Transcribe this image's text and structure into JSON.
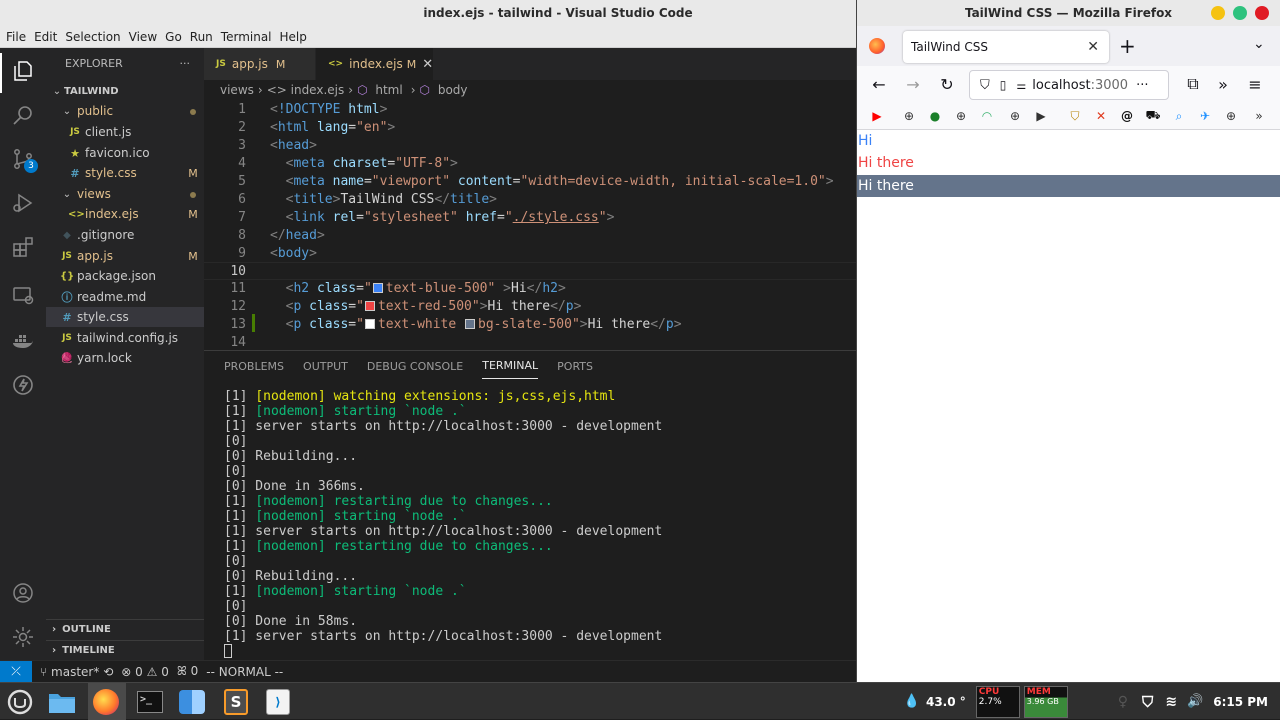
{
  "vscode": {
    "window_title": "index.ejs - tailwind - Visual Studio Code",
    "menu": [
      "File",
      "Edit",
      "Selection",
      "View",
      "Go",
      "Run",
      "Terminal",
      "Help"
    ],
    "scm_badge": "3",
    "explorer": {
      "header": "EXPLORER",
      "more": "···",
      "root": "TAILWIND",
      "items": [
        {
          "label": "public",
          "type": "folder",
          "icon": "chevron-down",
          "mark": ""
        },
        {
          "label": "client.js",
          "type": "js",
          "icon": "JS",
          "mark": ""
        },
        {
          "label": "favicon.ico",
          "type": "ico",
          "icon": "★",
          "mark": ""
        },
        {
          "label": "style.css",
          "type": "css",
          "icon": "#",
          "mark": "M"
        },
        {
          "label": "views",
          "type": "folder",
          "icon": "chevron-down",
          "mark": ""
        },
        {
          "label": "index.ejs",
          "type": "ejs",
          "icon": "<>",
          "mark": "M"
        },
        {
          "label": ".gitignore",
          "type": "git",
          "icon": "◆",
          "mark": ""
        },
        {
          "label": "app.js",
          "type": "js",
          "icon": "JS",
          "mark": "M"
        },
        {
          "label": "package.json",
          "type": "json",
          "icon": "{}",
          "mark": ""
        },
        {
          "label": "readme.md",
          "type": "md",
          "icon": "ⓘ",
          "mark": ""
        },
        {
          "label": "style.css",
          "type": "css",
          "icon": "#",
          "mark": ""
        },
        {
          "label": "tailwind.config.js",
          "type": "js",
          "icon": "JS",
          "mark": ""
        },
        {
          "label": "yarn.lock",
          "type": "yarn",
          "icon": "🧶",
          "mark": ""
        }
      ],
      "outline": "OUTLINE",
      "timeline": "TIMELINE"
    },
    "tabs": [
      {
        "icon": "JS",
        "label": "app.js",
        "mark": "M"
      },
      {
        "icon": "<>",
        "label": "index.ejs",
        "mark": "M",
        "close": "✕"
      }
    ],
    "breadcrumb": [
      "views",
      "›",
      "<> index.ejs",
      "›",
      "html",
      "›",
      "body"
    ],
    "code": {
      "line_numbers": [
        "1",
        "2",
        "3",
        "4",
        "5",
        "6",
        "7",
        "8",
        "9",
        "10",
        "11",
        "12",
        "13",
        "14"
      ]
    },
    "panel_tabs": [
      "PROBLEMS",
      "OUTPUT",
      "DEBUG CONSOLE",
      "TERMINAL",
      "PORTS"
    ],
    "terminal": [
      {
        "text": "[1] ",
        "rest": "[nodemon] watching extensions: js,css,ejs,html",
        "color": "yellow"
      },
      {
        "text": "[1] ",
        "rest": "[nodemon] starting `node .`",
        "color": "green"
      },
      {
        "text": "[1] server starts on http://localhost:3000 - development",
        "rest": "",
        "color": ""
      },
      {
        "text": "[0]",
        "rest": "",
        "color": ""
      },
      {
        "text": "[0] Rebuilding...",
        "rest": "",
        "color": ""
      },
      {
        "text": "[0]",
        "rest": "",
        "color": ""
      },
      {
        "text": "[0] Done in 366ms.",
        "rest": "",
        "color": ""
      },
      {
        "text": "[1] ",
        "rest": "[nodemon] restarting due to changes...",
        "color": "green"
      },
      {
        "text": "[1] ",
        "rest": "[nodemon] starting `node .`",
        "color": "green"
      },
      {
        "text": "[1] server starts on http://localhost:3000 - development",
        "rest": "",
        "color": ""
      },
      {
        "text": "[1] ",
        "rest": "[nodemon] restarting due to changes...",
        "color": "green"
      },
      {
        "text": "[0]",
        "rest": "",
        "color": ""
      },
      {
        "text": "[0] Rebuilding...",
        "rest": "",
        "color": ""
      },
      {
        "text": "[1] ",
        "rest": "[nodemon] starting `node .`",
        "color": "green"
      },
      {
        "text": "[0]",
        "rest": "",
        "color": ""
      },
      {
        "text": "[0] Done in 58ms.",
        "rest": "",
        "color": ""
      },
      {
        "text": "[1] server starts on http://localhost:3000 - development",
        "rest": "",
        "color": ""
      }
    ],
    "status": {
      "branch": "master*",
      "errors": "0",
      "warnings": "0",
      "ports": "0",
      "mode": "-- NORMAL --"
    }
  },
  "firefox": {
    "window_title": "TailWind CSS — Mozilla Firefox",
    "tab_title": "TailWind CSS",
    "url_host": "localhost",
    "url_port": ":3000",
    "page_lines": [
      "Hi",
      "Hi there",
      "Hi there"
    ]
  },
  "tray": {
    "temp": "43.0 °",
    "cpu_label": "CPU",
    "cpu_value": "2.7%",
    "mem_label": "MEM",
    "mem_value": "3.96 GB",
    "time": "6:15 PM"
  },
  "colors": {
    "blue500": "#3b82f6",
    "red500": "#ef4444",
    "slate500": "#64748b",
    "vscode_accent": "#007acc"
  }
}
